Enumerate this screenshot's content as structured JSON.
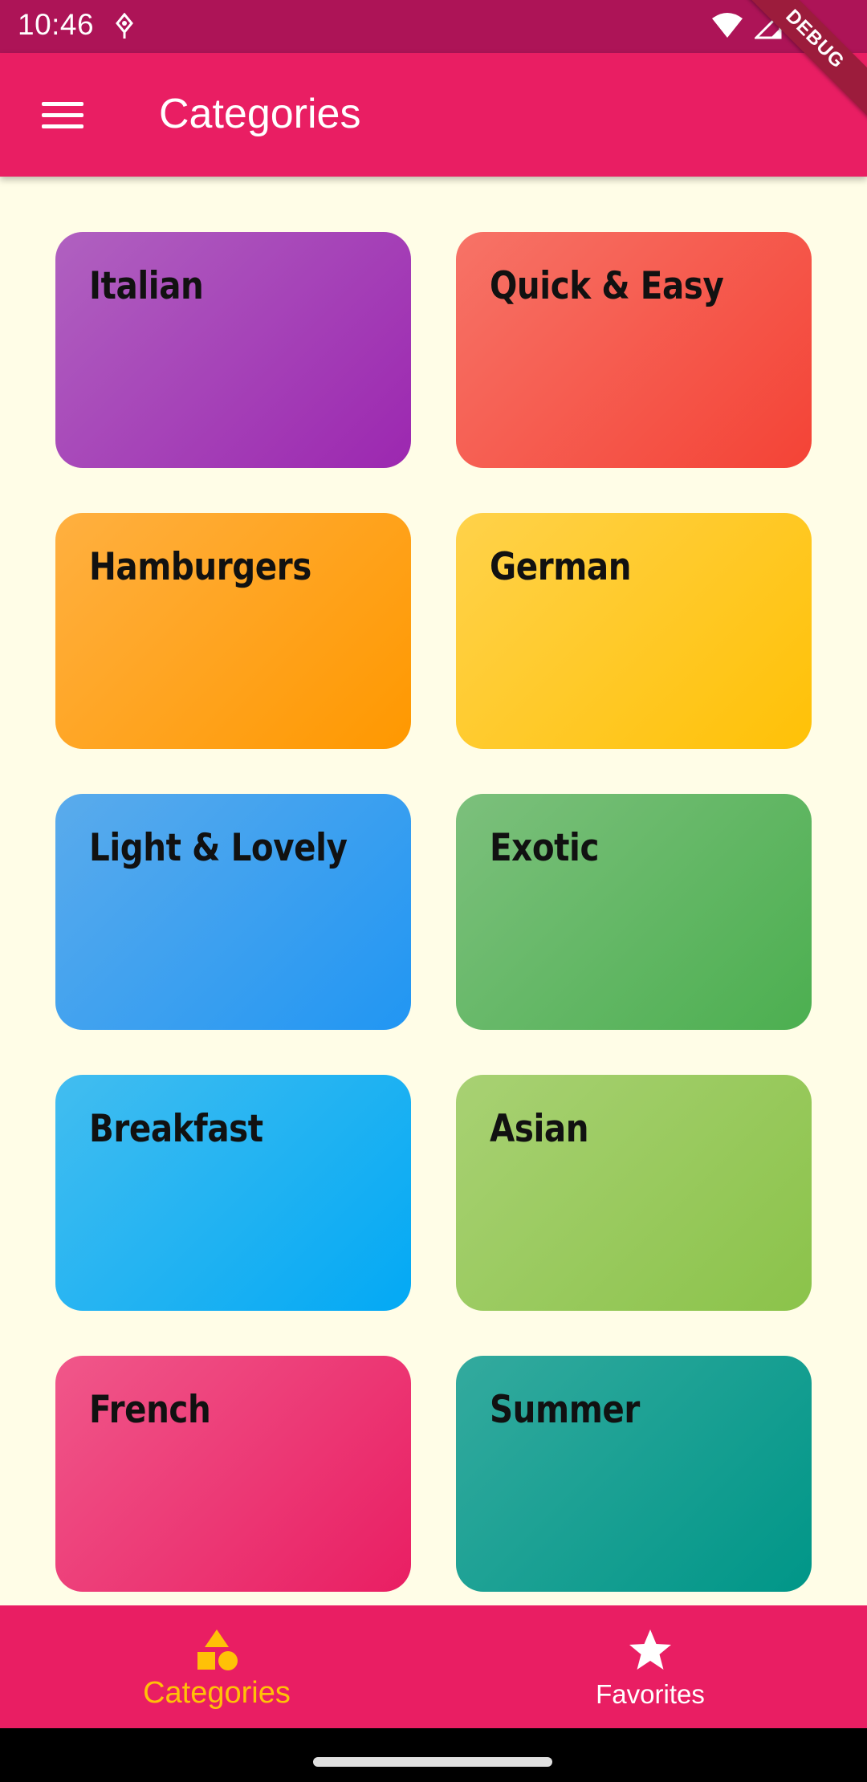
{
  "status_bar": {
    "time": "10:46",
    "icons": [
      "notification-icon",
      "wifi-icon",
      "signal-icon",
      "battery-icon"
    ]
  },
  "debug_ribbon": "DEBUG",
  "app_bar": {
    "title": "Categories",
    "menu_icon": "hamburger-menu-icon"
  },
  "categories": [
    {
      "label": "Italian",
      "from": "#b061c0",
      "to": "#9c27b0"
    },
    {
      "label": "Quick & Easy",
      "from": "#f77367",
      "to": "#f44336"
    },
    {
      "label": "Hamburgers",
      "from": "#ffb040",
      "to": "#ff9800"
    },
    {
      "label": "German",
      "from": "#ffd24a",
      "to": "#ffc107"
    },
    {
      "label": "Light & Lovely",
      "from": "#5aabec",
      "to": "#2196f3"
    },
    {
      "label": "Exotic",
      "from": "#7cc07c",
      "to": "#4caf50"
    },
    {
      "label": "Breakfast",
      "from": "#42bdf0",
      "to": "#03a9f4"
    },
    {
      "label": "Asian",
      "from": "#a8d173",
      "to": "#8bc34a"
    },
    {
      "label": "French",
      "from": "#f0578a",
      "to": "#e91e63"
    },
    {
      "label": "Summer",
      "from": "#33aa9e",
      "to": "#009688"
    }
  ],
  "bottom_nav": {
    "items": [
      {
        "label": "Categories",
        "icon": "category-icon",
        "active": true
      },
      {
        "label": "Favorites",
        "icon": "star-icon",
        "active": false
      }
    ],
    "active_color": "#ffc107",
    "inactive_color": "#ffffff"
  }
}
